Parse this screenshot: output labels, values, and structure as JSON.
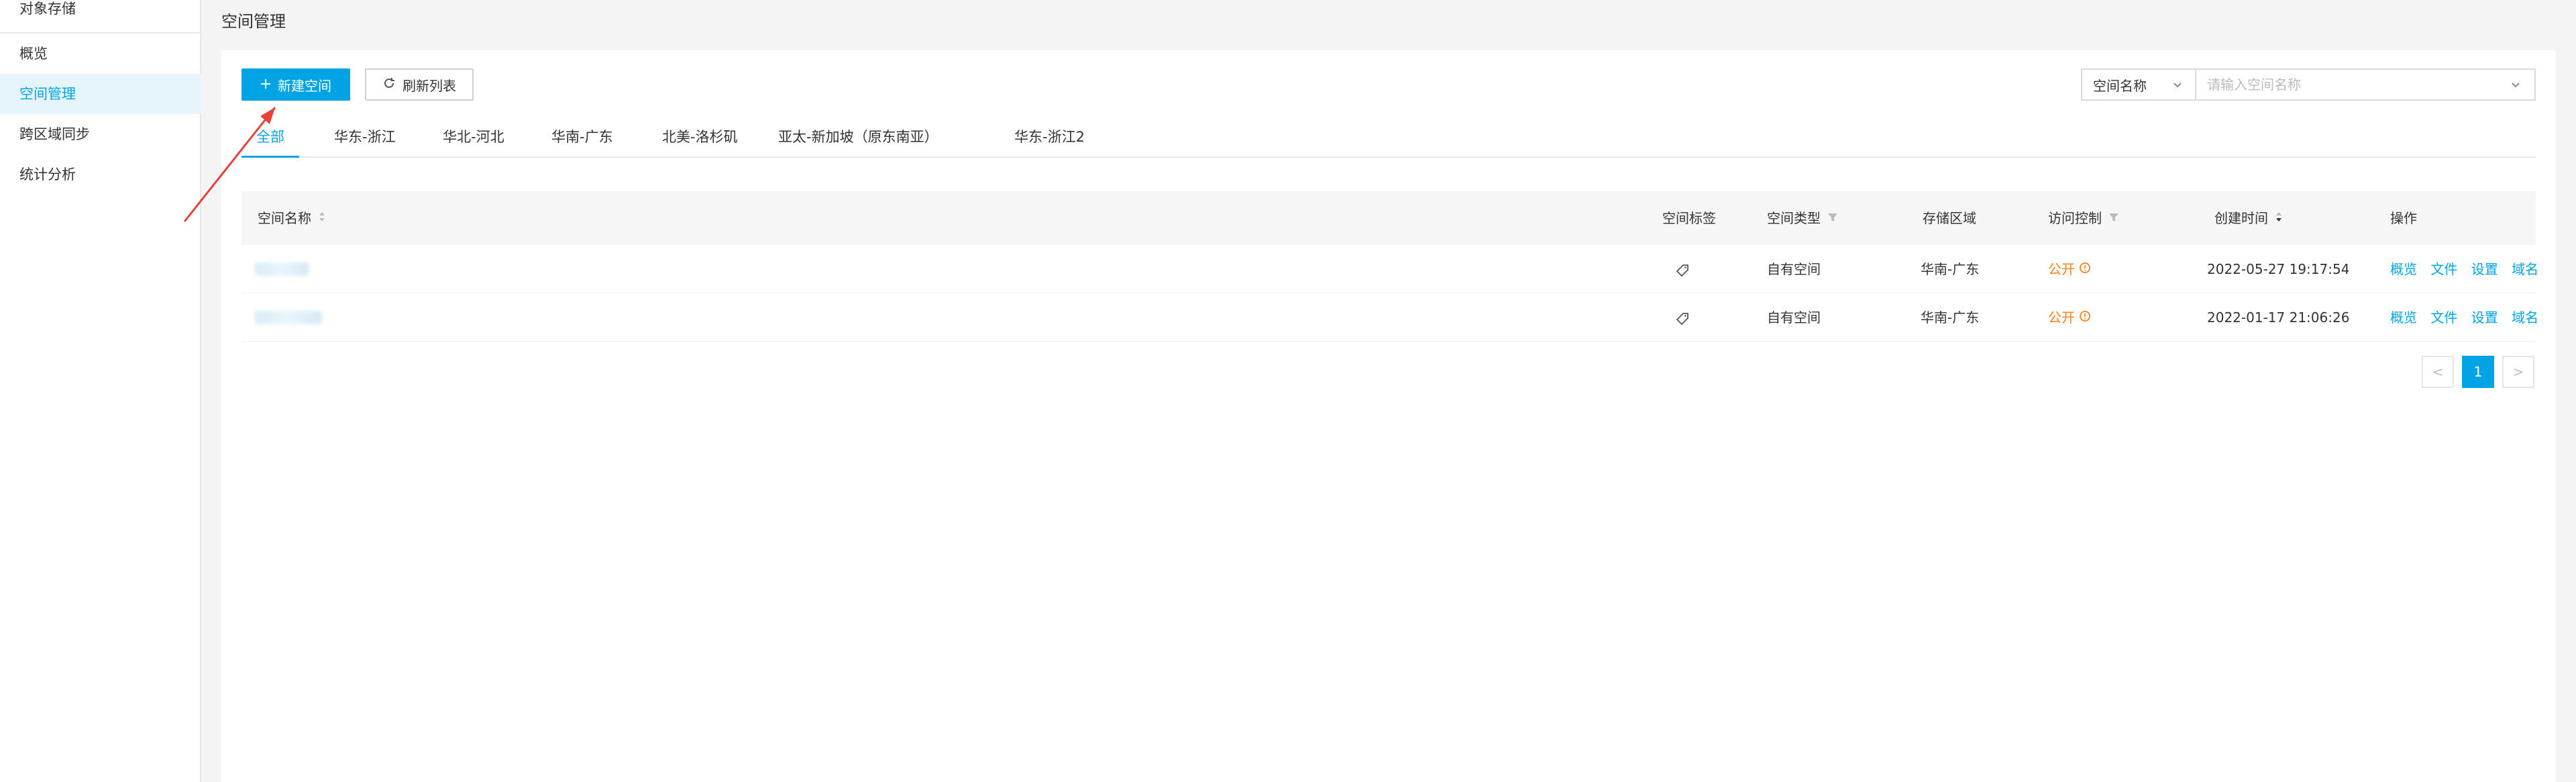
{
  "sidebar": {
    "section_title": "对象存储",
    "items": [
      {
        "label": "概览",
        "active": false
      },
      {
        "label": "空间管理",
        "active": true
      },
      {
        "label": "跨区域同步",
        "active": false
      },
      {
        "label": "统计分析",
        "active": false
      }
    ]
  },
  "page": {
    "title": "空间管理"
  },
  "toolbar": {
    "create_label": "新建空间",
    "refresh_label": "刷新列表",
    "search_field_selected": "空间名称",
    "search_placeholder": "请输入空间名称"
  },
  "tabs": [
    "全部",
    "华东-浙江",
    "华北-河北",
    "华南-广东",
    "北美-洛杉矶",
    "亚太-新加坡（原东南亚）",
    "华东-浙江2"
  ],
  "table": {
    "headers": {
      "name": "空间名称",
      "tag": "空间标签",
      "type": "空间类型",
      "region": "存储区域",
      "access": "访问控制",
      "created": "创建时间",
      "ops": "操作"
    },
    "rows": [
      {
        "type": "自有空间",
        "region": "华南-广东",
        "access": "公开",
        "created": "2022-05-27 19:17:54",
        "ops": [
          "概览",
          "文件",
          "设置",
          "域名"
        ]
      },
      {
        "type": "自有空间",
        "region": "华南-广东",
        "access": "公开",
        "created": "2022-01-17 21:06:26",
        "ops": [
          "概览",
          "文件",
          "设置",
          "域名"
        ]
      }
    ]
  },
  "pagination": {
    "current": "1",
    "prev": "<",
    "next": ">"
  },
  "colors": {
    "accent": "#00a4e4",
    "public": "#f5821f",
    "annotation": "#e8413a"
  }
}
